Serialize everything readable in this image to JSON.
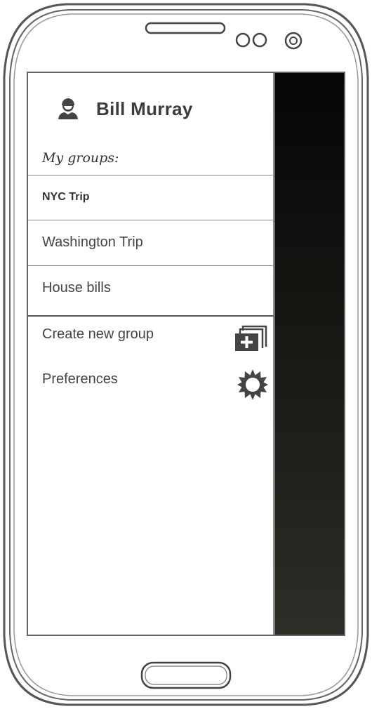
{
  "drawer": {
    "user_name": "Bill Murray",
    "groups_label": "My groups:",
    "groups": [
      {
        "label": "NYC Trip",
        "active": true
      },
      {
        "label": "Washington Trip",
        "active": false
      },
      {
        "label": "House bills",
        "active": false
      }
    ],
    "menu": [
      {
        "label": "Create new group",
        "icon": "add-group-icon"
      },
      {
        "label": "Preferences",
        "icon": "gear-icon"
      }
    ]
  },
  "colors": {
    "text": "#444444",
    "overlay": "#0b0b0b"
  }
}
